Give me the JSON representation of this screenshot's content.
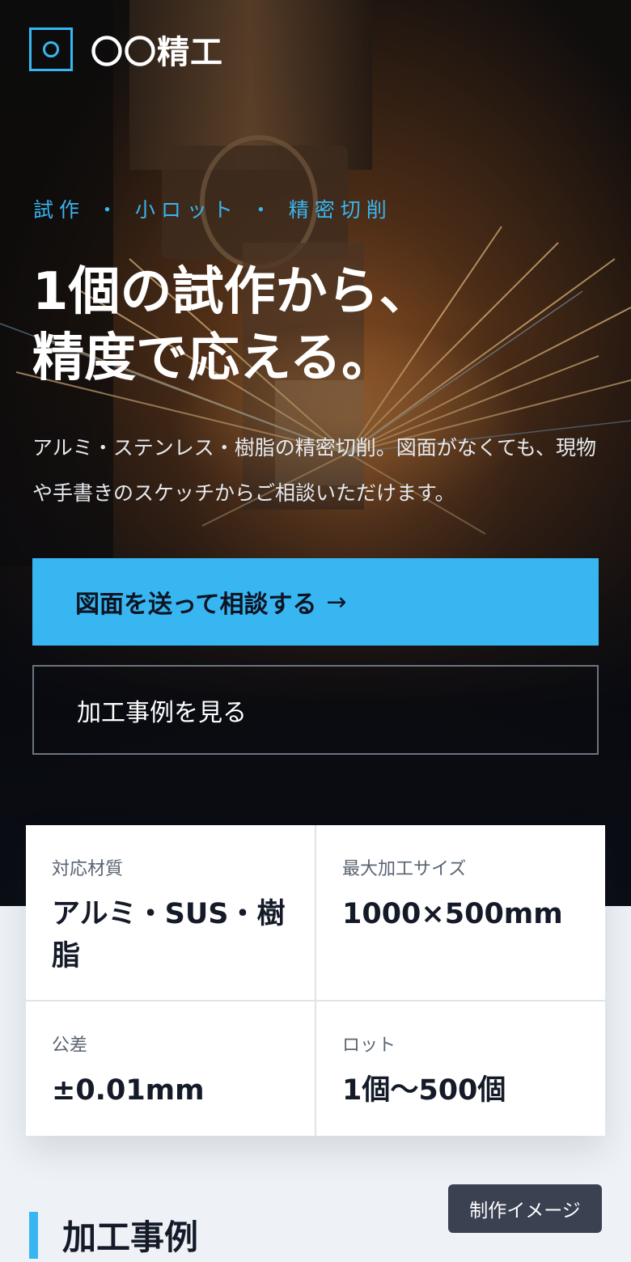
{
  "brand": {
    "name": "〇〇精工",
    "accent": "#38b6f2"
  },
  "hero": {
    "tagline": "試作 ・ 小ロット ・ 精密切削",
    "headline_line1": "1個の試作から、",
    "headline_line2": "精度で応える。",
    "lead": "アルミ・ステンレス・樹脂の精密切削。図面がなくても、現物や手書きのスケッチからご相談いただけます。",
    "primary_cta": "図面を送って相談する",
    "primary_cta_arrow": "→",
    "secondary_cta": "加工事例を見る"
  },
  "specs": [
    {
      "label": "対応材質",
      "value": "アルミ・SUS・樹脂"
    },
    {
      "label": "最大加工サイズ",
      "value": "1000×500mm"
    },
    {
      "label": "公差",
      "value": "±0.01mm"
    },
    {
      "label": "ロット",
      "value": "1個〜500個"
    }
  ],
  "section": {
    "title": "加工事例",
    "badge": "制作イメージ"
  }
}
